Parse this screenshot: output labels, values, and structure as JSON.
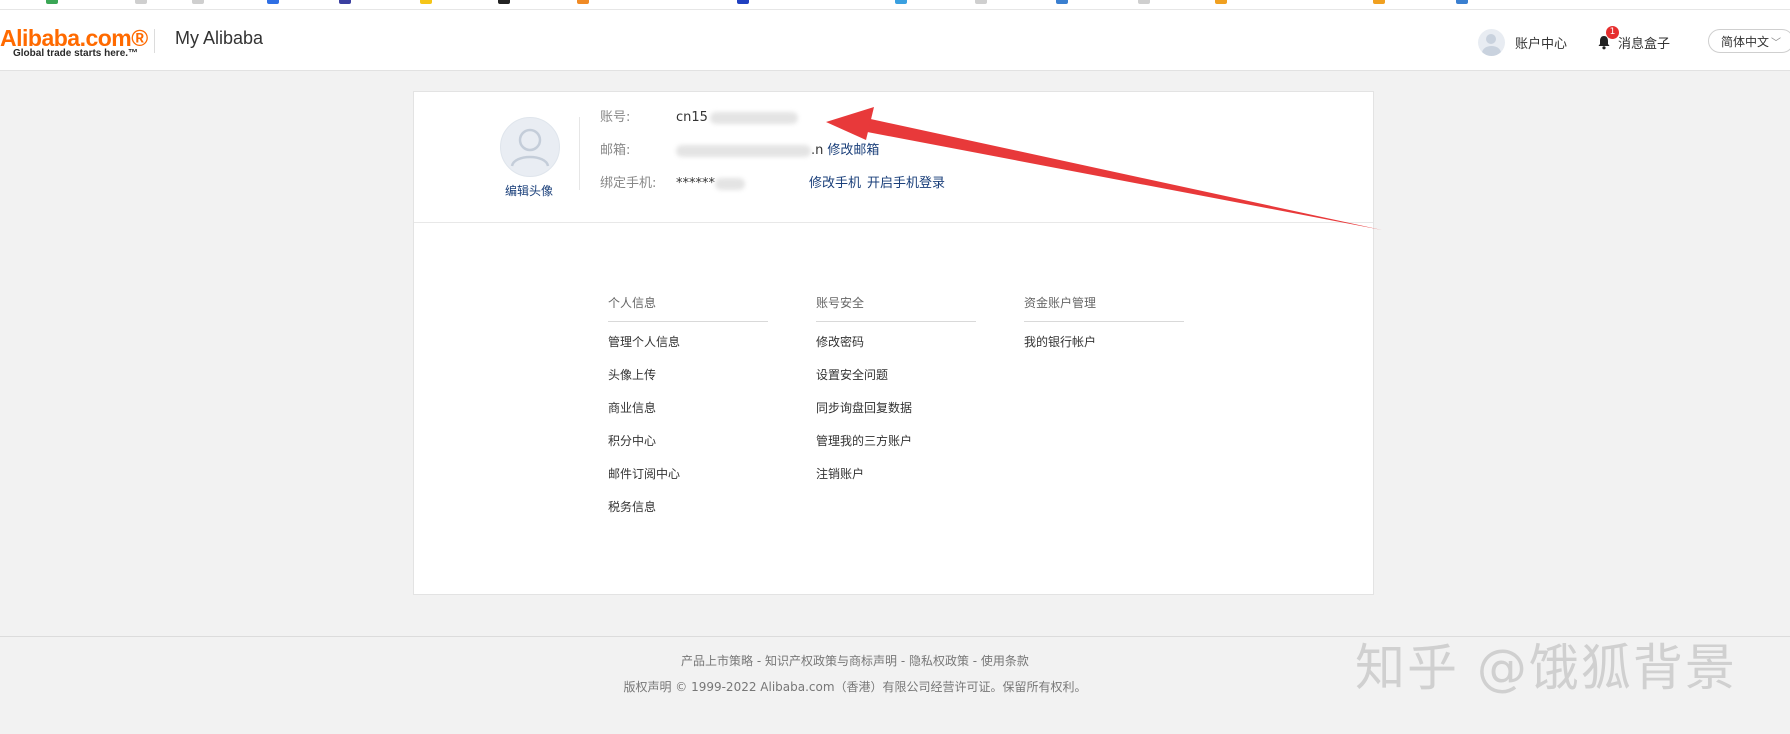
{
  "header": {
    "logo_text": "Alibaba.com®",
    "logo_tagline": "Global trade starts here.™",
    "title": "My Alibaba",
    "account_center": "账户中心",
    "message_box": "消息盒子",
    "message_badge": "1",
    "language": "简体中文"
  },
  "profile": {
    "edit_avatar": "编辑头像",
    "account_label": "账号:",
    "account_value": "cn15",
    "email_label": "邮箱:",
    "email_value_tail": ".n",
    "change_email": "修改邮箱",
    "phone_label": "绑定手机:",
    "phone_value": "******",
    "change_phone": "修改手机",
    "enable_phone_login": "开启手机登录"
  },
  "menu": {
    "columns": [
      {
        "title": "个人信息",
        "links": [
          "管理个人信息",
          "头像上传",
          "商业信息",
          "积分中心",
          "邮件订阅中心",
          "税务信息"
        ]
      },
      {
        "title": "账号安全",
        "links": [
          "修改密码",
          "设置安全问题",
          "同步询盘回复数据",
          "管理我的三方账户",
          "注销账户"
        ]
      },
      {
        "title": "资金账户管理",
        "links": [
          "我的银行帐户"
        ]
      }
    ]
  },
  "footer": {
    "links_line": "产品上市策略 - 知识产权政策与商标声明 - 隐私权政策 - 使用条款",
    "copyright": "版权声明 © 1999-2022 Alibaba.com（香港）有限公司经营许可证。保留所有权利。"
  },
  "watermark": "知乎 @饿狐背景",
  "colors": {
    "brand_orange": "#ff6a00",
    "link_blue": "#1a3f7a",
    "annotation_red": "#e8393a",
    "badge_red": "#e62e2e"
  }
}
